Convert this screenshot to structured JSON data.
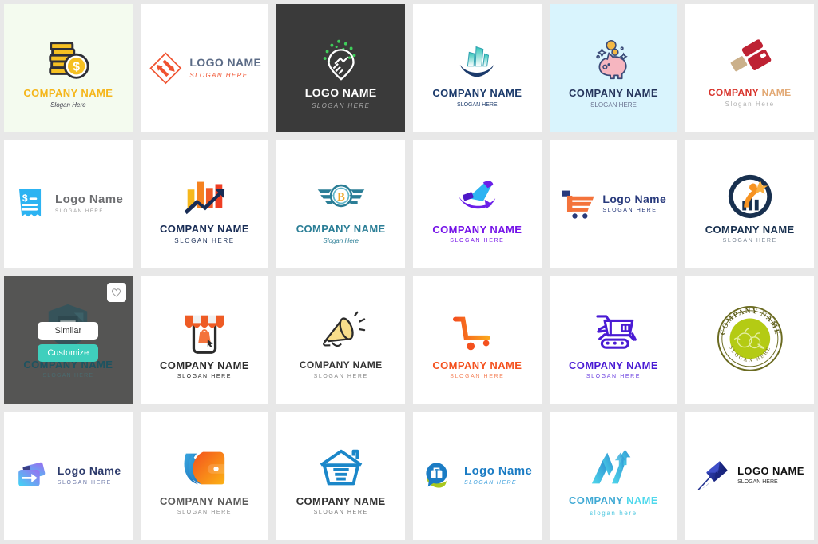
{
  "page": {
    "background": "#e8e8e8",
    "columns": 6,
    "rows": 4,
    "total_cards": 24
  },
  "hover_overlay": {
    "card_index": 12,
    "overlay_color": "#555554",
    "similar_label": "Similar",
    "customize_label": "Customize",
    "customize_color": "#3fcfbd",
    "favorite_icon": "heart-icon"
  },
  "cards": [
    {
      "id": "card-01",
      "icon": "coin-stack-dollar-icon",
      "title": "COMPANY NAME",
      "slogan": "Slogan Here",
      "bg": "#f4fbef",
      "title_color": "#f5b61b",
      "slogan_color": "#3c3c4a",
      "title_size": "13px",
      "slogan_size": "8px",
      "slogan_style": "italic-serif",
      "layout": "stacked"
    },
    {
      "id": "card-02",
      "icon": "diamond-arrows-icon",
      "title": "LOGO NAME",
      "slogan": "SLOGAN HERE",
      "bg": "#ffffff",
      "title_color": "#5b6b86",
      "slogan_color": "#f0522f",
      "title_size": "14px",
      "slogan_size": "8px",
      "slogan_style": "italic",
      "layout": "inline"
    },
    {
      "id": "card-03",
      "icon": "handshake-pin-icon",
      "title": "LOGO NAME",
      "slogan": "SLOGAN HERE",
      "bg": "#3a3a3a",
      "title_color": "#ffffff",
      "slogan_color": "#a8a8a8",
      "title_size": "14px",
      "slogan_size": "8px",
      "slogan_style": "italic",
      "layout": "stacked"
    },
    {
      "id": "card-04",
      "icon": "buildings-wave-icon",
      "title": "COMPANY NAME",
      "slogan": "SLOGAN HERE",
      "bg": "#ffffff",
      "title_color": "#1b3a6b",
      "slogan_color": "#1b3a6b",
      "title_size": "13px",
      "slogan_size": "7px",
      "slogan_style": "serif",
      "layout": "stacked"
    },
    {
      "id": "card-05",
      "icon": "piggy-bank-icon",
      "title": "COMPANY NAME",
      "slogan": "SLOGAN HERE",
      "bg": "#d9f4fd",
      "title_color": "#26355c",
      "slogan_color": "#6a7290",
      "title_size": "13px",
      "slogan_size": "8px",
      "slogan_style": "serif",
      "layout": "stacked"
    },
    {
      "id": "card-06",
      "icon": "credit-cards-icon",
      "title": "COMPANY NAME",
      "slogan": "Slogan Here",
      "bg": "#ffffff",
      "title_color": "#d8342c",
      "title_color_2": "#e2a873",
      "slogan_color": "#b0b0b0",
      "title_size": "12px",
      "slogan_size": "8px",
      "slogan_style": "normal",
      "layout": "stacked"
    },
    {
      "id": "card-07",
      "icon": "invoice-dollar-icon",
      "title": "Logo Name",
      "slogan": "SLOGAN HERE",
      "bg": "#ffffff",
      "title_color": "#6d6e71",
      "slogan_color": "#9a9a9a",
      "title_size": "15px",
      "slogan_size": "6px",
      "slogan_style": "normal",
      "layout": "inline"
    },
    {
      "id": "card-08",
      "icon": "bar-chart-arrow-icon",
      "title": "COMPANY NAME",
      "slogan": "SLOGAN HERE",
      "bg": "#ffffff",
      "title_color": "#182c55",
      "slogan_color": "#182c55",
      "title_size": "13px",
      "slogan_size": "8px",
      "slogan_style": "normal",
      "layout": "stacked"
    },
    {
      "id": "card-09",
      "icon": "bitcoin-wings-icon",
      "title": "COMPANY NAME",
      "slogan": "Slogan Here",
      "bg": "#ffffff",
      "title_color": "#2b7e96",
      "slogan_color": "#2b7e96",
      "title_size": "13px",
      "slogan_size": "8px",
      "slogan_style": "italic-serif",
      "layout": "stacked"
    },
    {
      "id": "card-10",
      "icon": "rocket-swoosh-icon",
      "title": "COMPANY NAME",
      "slogan": "SLOGAN HERE",
      "bg": "#ffffff",
      "title_color": "#7412e8",
      "slogan_color": "#7412e8",
      "title_size": "13px",
      "slogan_size": "7px",
      "slogan_style": "normal",
      "layout": "stacked"
    },
    {
      "id": "card-11",
      "icon": "shopping-cart-e-icon",
      "title": "Logo Name",
      "slogan": "SLOGAN HERE",
      "bg": "#ffffff",
      "title_color": "#283a7c",
      "slogan_color": "#283a7c",
      "title_size": "14px",
      "slogan_size": "7px",
      "slogan_style": "normal",
      "layout": "inline"
    },
    {
      "id": "card-12",
      "icon": "person-star-chart-icon",
      "title": "COMPANY NAME",
      "slogan": "SLOGAN HERE",
      "bg": "#ffffff",
      "title_color": "#18304f",
      "slogan_color": "#7b8796",
      "title_size": "13px",
      "slogan_size": "7px",
      "slogan_style": "normal",
      "layout": "stacked"
    },
    {
      "id": "card-13",
      "icon": "shield-building-icon",
      "title": "COMPANY NAME",
      "slogan": "SLOGAN HERE",
      "bg": "#ffffff",
      "title_color": "#1d5360",
      "slogan_color": "#4a6b6f",
      "title_size": "13px",
      "slogan_size": "7px",
      "slogan_style": "normal",
      "layout": "stacked",
      "state": "hovered"
    },
    {
      "id": "card-14",
      "icon": "mobile-shop-icon",
      "title": "COMPANY NAME",
      "slogan": "SLOGAN HERE",
      "bg": "#ffffff",
      "title_color": "#2b2b2b",
      "slogan_color": "#2b2b2b",
      "title_size": "13px",
      "slogan_size": "7px",
      "slogan_style": "normal",
      "layout": "stacked"
    },
    {
      "id": "card-15",
      "icon": "megaphone-icon",
      "title": "COMPANY NAME",
      "slogan": "SLOGAN HERE",
      "bg": "#ffffff",
      "title_color": "#333333",
      "slogan_color": "#8c8c8c",
      "title_size": "12px",
      "slogan_size": "7px",
      "slogan_style": "normal",
      "layout": "stacked"
    },
    {
      "id": "card-16",
      "icon": "cart-speed-lines-icon",
      "title": "COMPANY NAME",
      "slogan": "SLOGAN HERE",
      "bg": "#ffffff",
      "title_color": "#f4511e",
      "slogan_color": "#f4855e",
      "title_size": "13px",
      "slogan_size": "7px",
      "slogan_style": "normal",
      "layout": "stacked"
    },
    {
      "id": "card-17",
      "icon": "robot-cart-icon",
      "title": "COMPANY NAME",
      "slogan": "SLOGAN HERE",
      "bg": "#ffffff",
      "title_color": "#4a1bd4",
      "slogan_color": "#6f45e0",
      "title_size": "13px",
      "slogan_size": "7px",
      "slogan_style": "normal",
      "layout": "stacked"
    },
    {
      "id": "card-18",
      "icon": "vegetable-badge-icon",
      "title": "COMPANY NAME",
      "slogan": "SLOGAN HERE",
      "bg": "#ffffff",
      "title_color": "#6b6b21",
      "slogan_color": "#6b6b21",
      "title_size": "0px",
      "slogan_size": "0px",
      "slogan_style": "normal",
      "layout": "badge"
    },
    {
      "id": "card-19",
      "icon": "send-card-arrow-icon",
      "title": "Logo Name",
      "slogan": "SLOGAN HERE",
      "bg": "#ffffff",
      "title_color": "#2c3a6b",
      "slogan_color": "#6d79a8",
      "title_size": "14px",
      "slogan_size": "7px",
      "slogan_style": "normal",
      "layout": "inline"
    },
    {
      "id": "card-20",
      "icon": "wallet-swoosh-icon",
      "title": "COMPANY NAME",
      "slogan": "SLOGAN HERE",
      "bg": "#ffffff",
      "title_color": "#5b5b5b",
      "slogan_color": "#8d8d8d",
      "title_size": "13px",
      "slogan_size": "7px",
      "slogan_style": "normal",
      "layout": "stacked"
    },
    {
      "id": "card-21",
      "icon": "house-cart-icon",
      "title": "COMPANY NAME",
      "slogan": "SLOGAN HERE",
      "bg": "#ffffff",
      "title_color": "#333333",
      "slogan_color": "#7b7b7b",
      "title_size": "13px",
      "slogan_size": "7px",
      "slogan_style": "normal",
      "layout": "stacked"
    },
    {
      "id": "card-22",
      "icon": "briefcase-chat-icon",
      "title": "Logo Name",
      "slogan": "SLOGAN HERE",
      "bg": "#ffffff",
      "title_color": "#1b7cc4",
      "slogan_color": "#3fa0dc",
      "title_size": "15px",
      "slogan_size": "7px",
      "slogan_style": "italic",
      "layout": "inline"
    },
    {
      "id": "card-23",
      "icon": "growth-arrows-n-icon",
      "title": "COMPANY NAME",
      "slogan": "slogan here",
      "bg": "#ffffff",
      "title_color": "#3fa9d4",
      "title_color_2": "#4fd8ec",
      "slogan_color": "#4fc8e0",
      "title_size": "13px",
      "slogan_size": "8px",
      "slogan_style": "normal",
      "layout": "stacked"
    },
    {
      "id": "card-24",
      "icon": "envelope-dart-icon",
      "title": "LOGO NAME",
      "slogan": "SLOGAN HERE",
      "bg": "#ffffff",
      "title_color": "#111111",
      "slogan_color": "#333333",
      "title_size": "13px",
      "slogan_size": "7px",
      "slogan_style": "serif",
      "layout": "inline"
    }
  ]
}
